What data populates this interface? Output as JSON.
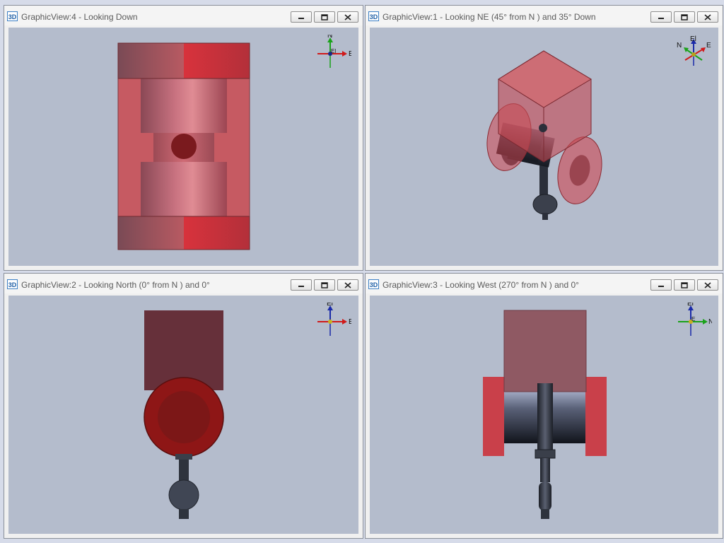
{
  "panes": {
    "tl": {
      "title": "GraphicView:4 - Looking Down",
      "badge": "3D"
    },
    "tr": {
      "title": "GraphicView:1 - Looking NE (45° from N ) and 35° Down",
      "badge": "3D"
    },
    "bl": {
      "title": "GraphicView:2 - Looking North (0° from N ) and 0°",
      "badge": "3D"
    },
    "br": {
      "title": "GraphicView:3 - Looking West (270° from N ) and 0°",
      "badge": "3D"
    }
  },
  "triads": {
    "tl": {
      "up": "N",
      "right": "E",
      "center": "El"
    },
    "tr": {
      "up": "El",
      "left": "N",
      "right": "E"
    },
    "bl": {
      "up": "El",
      "right": "E"
    },
    "br": {
      "up": "El",
      "right": "N",
      "center": "E"
    }
  },
  "colors": {
    "body_red": "#c9555e",
    "flange_red": "#d9434c",
    "dark_red": "#8e1616",
    "steel": "#3a3f4a",
    "viewport_bg": "#b4bccc"
  }
}
